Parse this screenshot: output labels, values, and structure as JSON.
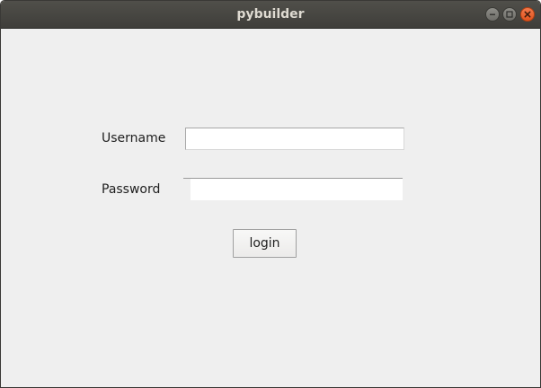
{
  "window": {
    "title": "pybuilder",
    "controls": {
      "minimize_icon": "minimize-icon",
      "maximize_icon": "maximize-icon",
      "close_icon": "close-icon"
    }
  },
  "form": {
    "username_label": "Username",
    "username_value": "",
    "password_label": "Password",
    "password_value": "",
    "login_label": "login"
  },
  "colors": {
    "titlebar": "#45443f",
    "background": "#efefef",
    "close_button": "#e95420"
  }
}
